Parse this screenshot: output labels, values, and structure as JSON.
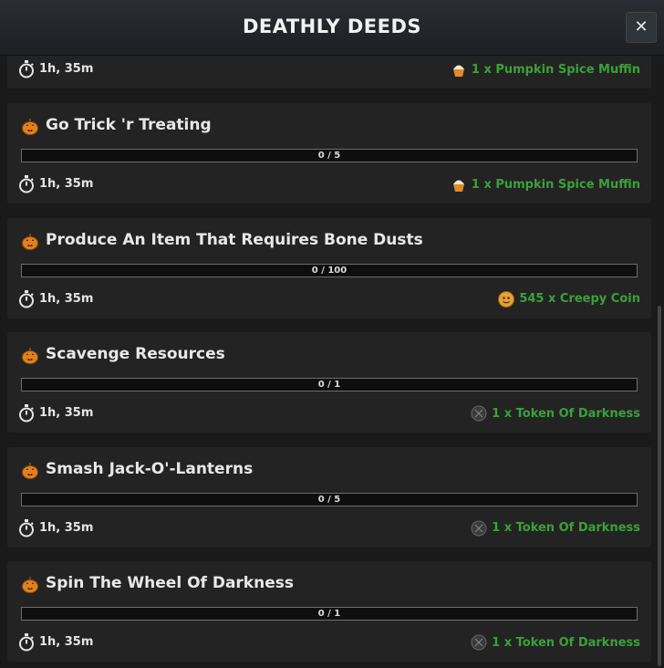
{
  "header": {
    "title": "DEATHLY DEEDS",
    "close_label": "✕"
  },
  "partial_card": {
    "timer": "1h, 35m",
    "reward": "1 x Pumpkin Spice Muffin",
    "reward_icon": "muffin-icon"
  },
  "quests": [
    {
      "name": "Go Trick 'r Treating",
      "progress_text": "0 / 5",
      "progress": 0,
      "timer": "1h, 35m",
      "reward": "1 x Pumpkin Spice Muffin",
      "reward_icon": "muffin-icon"
    },
    {
      "name": "Produce An Item That Requires Bone Dusts",
      "progress_text": "0 / 100",
      "progress": 0,
      "timer": "1h, 35m",
      "reward": "545 x Creepy Coin",
      "reward_icon": "creepy-coin-icon"
    },
    {
      "name": "Scavenge Resources",
      "progress_text": "0 / 1",
      "progress": 0,
      "timer": "1h, 35m",
      "reward": "1 x Token Of Darkness",
      "reward_icon": "token-of-darkness-icon"
    },
    {
      "name": "Smash Jack-O'-Lanterns",
      "progress_text": "0 / 5",
      "progress": 0,
      "timer": "1h, 35m",
      "reward": "1 x Token Of Darkness",
      "reward_icon": "token-of-darkness-icon"
    },
    {
      "name": "Spin The Wheel Of Darkness",
      "progress_text": "0 / 1",
      "progress": 0,
      "timer": "1h, 35m",
      "reward": "1 x Token Of Darkness",
      "reward_icon": "token-of-darkness-icon"
    }
  ],
  "colors": {
    "reward_green": "#3aa13a",
    "card_bg": "#232323",
    "page_bg": "#1a1a1a"
  }
}
